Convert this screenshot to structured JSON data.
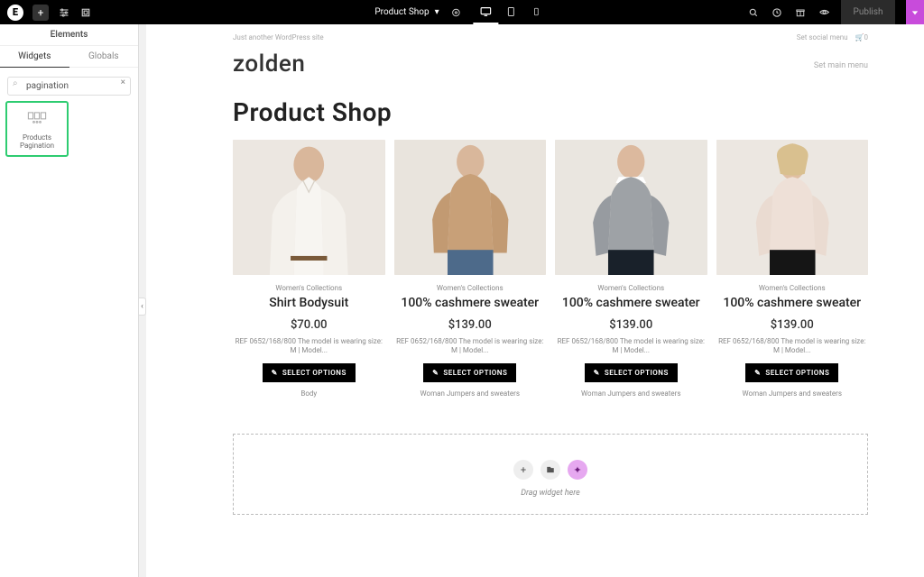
{
  "topbar": {
    "page_label": "Product Shop",
    "publish": "Publish"
  },
  "panel": {
    "title": "Elements",
    "tabs": {
      "widgets": "Widgets",
      "globals": "Globals"
    },
    "search_value": "pagination",
    "widget_label": "Products Pagination"
  },
  "preview": {
    "tagline": "Just another WordPress site",
    "social_menu": "Set social menu",
    "cart": "🛒0",
    "brand": "zolden",
    "set_main_menu": "Set main menu",
    "page_title": "Product Shop",
    "dropzone": "Drag widget here"
  },
  "products": [
    {
      "category": "Women's Collections",
      "title": "Shirt Bodysuit",
      "price": "$70.00",
      "desc": "REF 0652/168/800 The model is wearing size: M | Model...",
      "btn": "SELECT OPTIONS",
      "tags": "Body"
    },
    {
      "category": "Women's Collections",
      "title": "100% cashmere sweater",
      "price": "$139.00",
      "desc": "REF 0652/168/800 The model is wearing size: M | Model...",
      "btn": "SELECT OPTIONS",
      "tags": "Woman Jumpers and sweaters"
    },
    {
      "category": "Women's Collections",
      "title": "100% cashmere sweater",
      "price": "$139.00",
      "desc": "REF 0652/168/800 The model is wearing size: M | Model...",
      "btn": "SELECT OPTIONS",
      "tags": "Woman Jumpers and sweaters"
    },
    {
      "category": "Women's Collections",
      "title": "100% cashmere sweater",
      "price": "$139.00",
      "desc": "REF 0652/168/800 The model is wearing size: M | Model...",
      "btn": "SELECT OPTIONS",
      "tags": "Woman Jumpers and sweaters"
    }
  ]
}
